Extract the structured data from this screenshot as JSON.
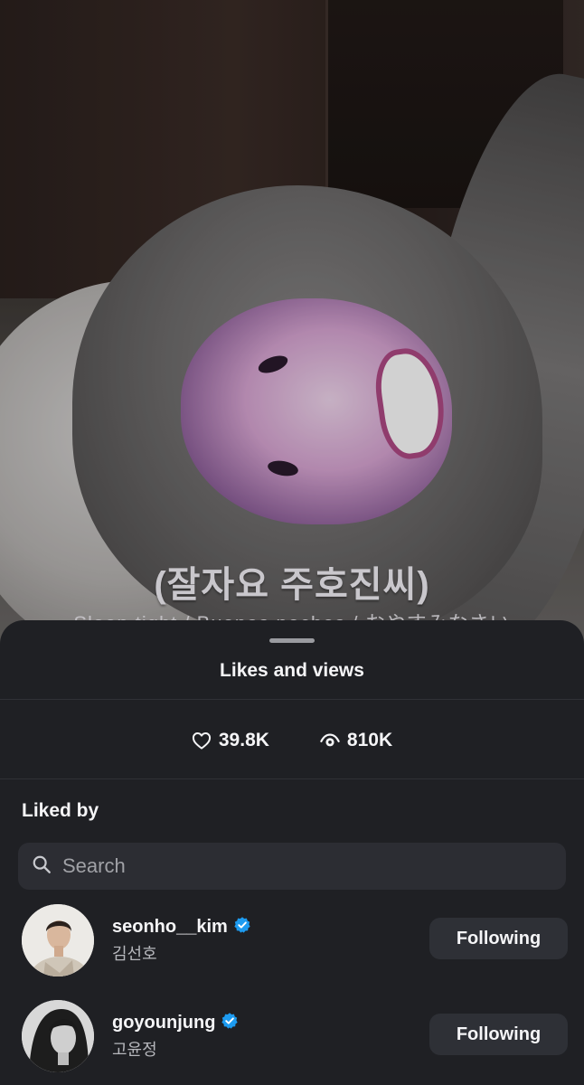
{
  "video": {
    "caption_main": "(잘자요 주호진씨)",
    "caption_sub": "Sleep tight / Buenas noches / おやすみなさい"
  },
  "sheet": {
    "title": "Likes and views",
    "likes": "39.8K",
    "views": "810K",
    "liked_by_title": "Liked by",
    "search_placeholder": "Search"
  },
  "users": [
    {
      "username": "seonho__kim",
      "fullname": "김선호",
      "verified": true,
      "button": "Following"
    },
    {
      "username": "goyounjung",
      "fullname": "고윤정",
      "verified": true,
      "button": "Following"
    }
  ],
  "colors": {
    "sheet_bg": "#1f2024",
    "verified_blue": "#1d9bf0",
    "button_bg": "#2e3036",
    "search_bg": "#2c2d33"
  },
  "icons": [
    "heart-icon",
    "eye-icon",
    "search-icon",
    "verified-badge-icon"
  ]
}
